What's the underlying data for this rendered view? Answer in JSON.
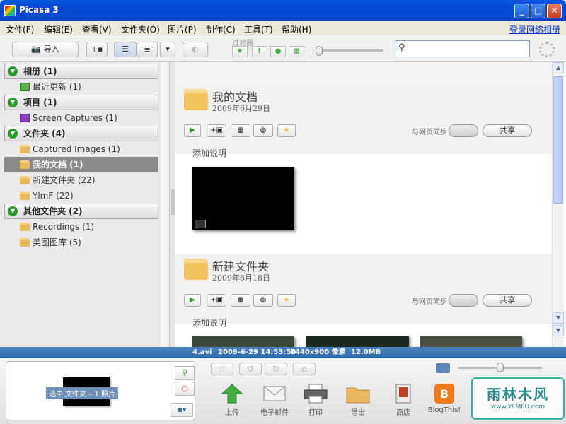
{
  "window": {
    "title": "Picasa 3"
  },
  "menu": {
    "items": [
      "文件(F)",
      "编辑(E)",
      "查看(V)",
      "文件夹(O)",
      "图片(P)",
      "制作(C)",
      "工具(T)",
      "帮助(H)"
    ],
    "signin": "登录网络相册"
  },
  "toolbar": {
    "import_label": "导入",
    "filter_label": "过滤器",
    "search_placeholder": ""
  },
  "sidebar": {
    "groups": [
      {
        "label": "相册 (1)",
        "items": [
          {
            "label": "最近更新 (1)",
            "icon": "album-icon",
            "selected": false
          }
        ]
      },
      {
        "label": "项目 (1)",
        "items": [
          {
            "label": "Screen Captures (1)",
            "icon": "project-icon",
            "selected": false
          }
        ]
      },
      {
        "label": "文件夹 (4)",
        "items": [
          {
            "label": "Captured Images (1)",
            "icon": "folder-icon",
            "selected": false
          },
          {
            "label": "我的文档 (1)",
            "icon": "folder-icon",
            "selected": true
          },
          {
            "label": "新建文件夹 (22)",
            "icon": "folder-icon",
            "selected": false
          },
          {
            "label": "YlmF (22)",
            "icon": "folder-icon",
            "selected": false
          }
        ]
      },
      {
        "label": "其他文件夹 (2)",
        "items": [
          {
            "label": "Recordings (1)",
            "icon": "folder-icon",
            "selected": false
          },
          {
            "label": "美图图库 (5)",
            "icon": "folder-icon",
            "selected": false
          }
        ]
      }
    ]
  },
  "main": {
    "folders": [
      {
        "name": "我的文档",
        "date": "2009年6月29日",
        "sync_label": "与网页同步",
        "share_label": "共享",
        "caption": "添加说明"
      },
      {
        "name": "新建文件夹",
        "date": "2009年6月18日",
        "sync_label": "与网页同步",
        "share_label": "共享",
        "caption": "添加说明"
      }
    ]
  },
  "status": {
    "filename": "4.avi",
    "datetime": "2009-6-29 14:53:50",
    "dimensions": "1440x900 像素",
    "size": "12.0MB"
  },
  "tray": {
    "selection_label": "选中 文件夹 – 1 照片",
    "tools": [
      {
        "label": "上传",
        "icon": "upload-icon"
      },
      {
        "label": "电子邮件",
        "icon": "email-icon"
      },
      {
        "label": "打印",
        "icon": "print-icon"
      },
      {
        "label": "导出",
        "icon": "export-icon"
      },
      {
        "label": "商店",
        "icon": "shop-icon"
      },
      {
        "label": "BlogThis!",
        "icon": "blogger-icon"
      }
    ]
  },
  "watermark": {
    "line1": "雨林木风",
    "line2": "www.YLMFU.com"
  },
  "colors": {
    "accent": "#0a58e0",
    "statusbar": "#3a76b4",
    "selected": "#8a8a8a"
  }
}
